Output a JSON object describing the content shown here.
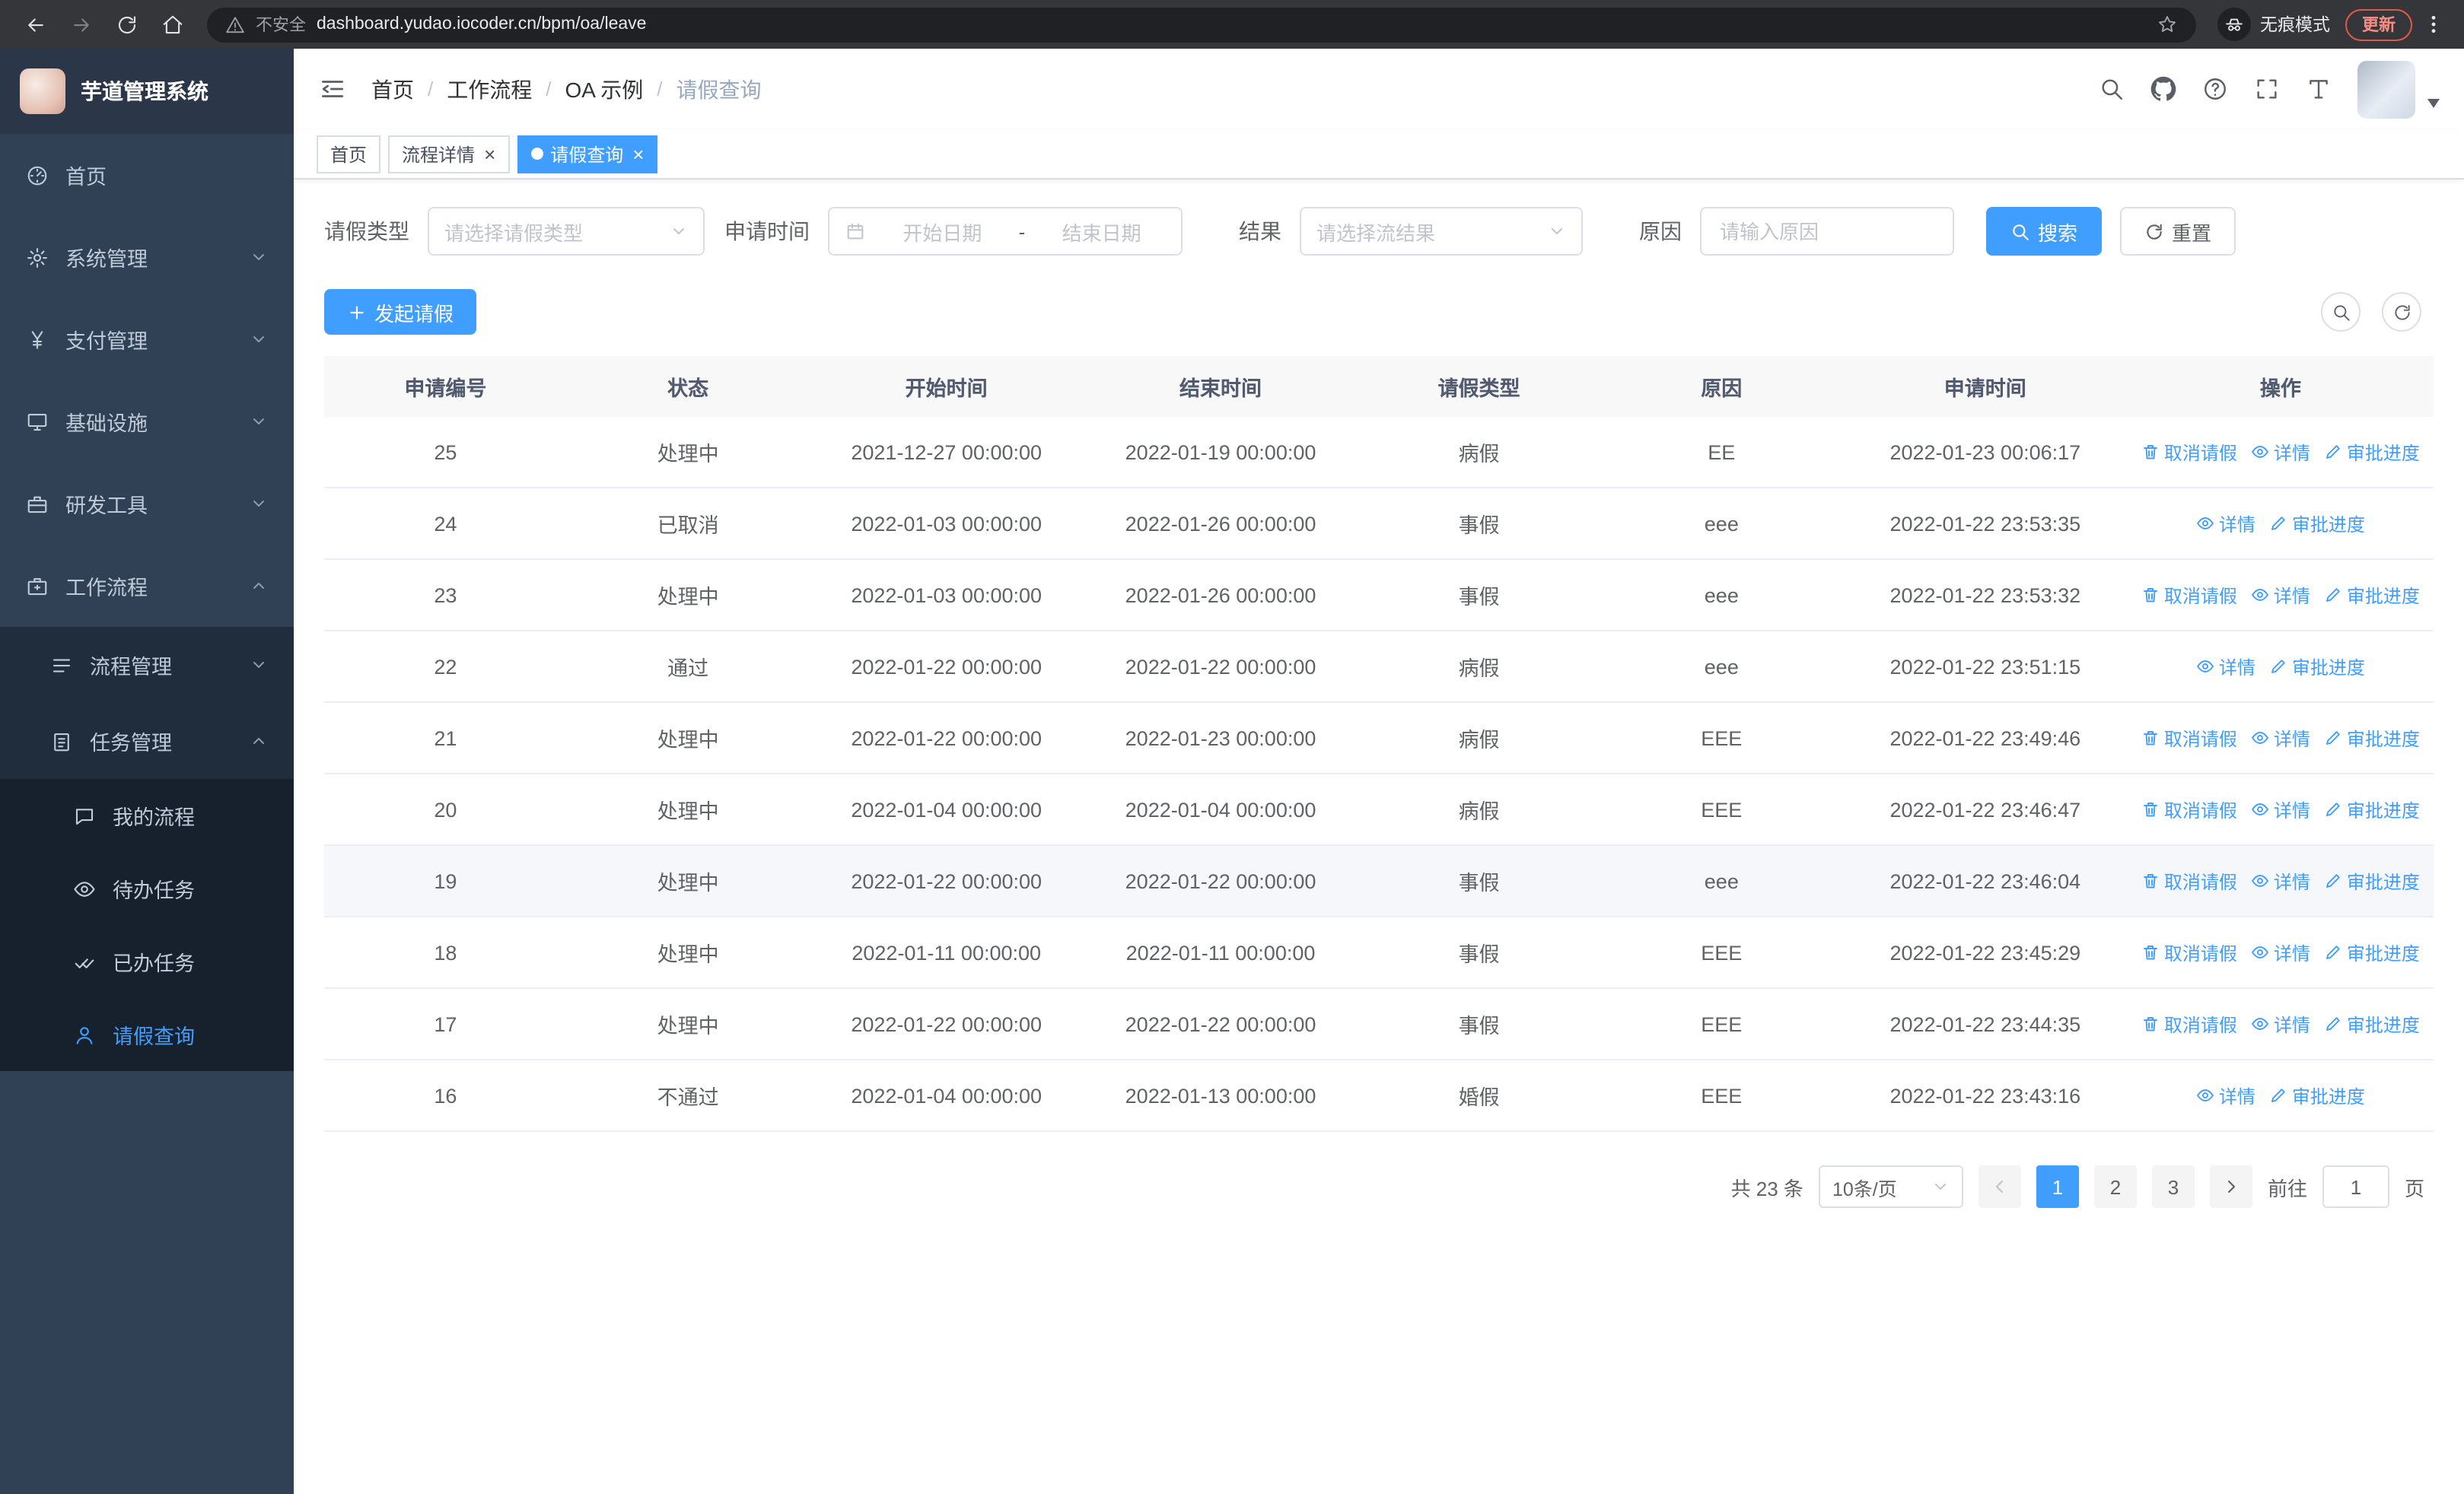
{
  "colors": {
    "primary": "#409eff",
    "sidebar_bg": "#304156",
    "submenu_bg": "#1f2d3d"
  },
  "icons": {
    "close": "×"
  },
  "browser": {
    "warning": "不安全",
    "url": "dashboard.yudao.iocoder.cn/bpm/oa/leave",
    "incognito": "无痕模式",
    "update": "更新"
  },
  "sidebar": {
    "title": "芋道管理系统",
    "home": "首页",
    "system": "系统管理",
    "payment": "支付管理",
    "infra": "基础设施",
    "devtools": "研发工具",
    "workflow": "工作流程",
    "process_mgmt": "流程管理",
    "task_mgmt": "任务管理",
    "my_process": "我的流程",
    "todo_task": "待办任务",
    "done_task": "已办任务",
    "leave_query": "请假查询"
  },
  "breadcrumb": {
    "home": "首页",
    "workflow": "工作流程",
    "oa": "OA 示例",
    "current": "请假查询"
  },
  "tabs": {
    "home": "首页",
    "process_detail": "流程详情",
    "leave_query": "请假查询"
  },
  "filters": {
    "leave_type_label": "请假类型",
    "leave_type_placeholder": "请选择请假类型",
    "apply_time_label": "申请时间",
    "start_date_placeholder": "开始日期",
    "range_separator": "-",
    "end_date_placeholder": "结束日期",
    "result_label": "结果",
    "result_placeholder": "请选择流结果",
    "reason_label": "原因",
    "reason_placeholder": "请输入原因",
    "search_button": "搜索",
    "reset_button": "重置"
  },
  "toolbar": {
    "create_button": "发起请假"
  },
  "actions": {
    "cancel": "取消请假",
    "detail": "详情",
    "progress": "审批进度"
  },
  "table": {
    "columns": [
      "申请编号",
      "状态",
      "开始时间",
      "结束时间",
      "请假类型",
      "原因",
      "申请时间",
      "操作"
    ],
    "rows": [
      {
        "id": "25",
        "status": "处理中",
        "start": "2021-12-27 00:00:00",
        "end": "2022-01-19 00:00:00",
        "type": "病假",
        "reason": "EE",
        "applied": "2022-01-23 00:06:17"
      },
      {
        "id": "24",
        "status": "已取消",
        "start": "2022-01-03 00:00:00",
        "end": "2022-01-26 00:00:00",
        "type": "事假",
        "reason": "eee",
        "applied": "2022-01-22 23:53:35"
      },
      {
        "id": "23",
        "status": "处理中",
        "start": "2022-01-03 00:00:00",
        "end": "2022-01-26 00:00:00",
        "type": "事假",
        "reason": "eee",
        "applied": "2022-01-22 23:53:32"
      },
      {
        "id": "22",
        "status": "通过",
        "start": "2022-01-22 00:00:00",
        "end": "2022-01-22 00:00:00",
        "type": "病假",
        "reason": "eee",
        "applied": "2022-01-22 23:51:15"
      },
      {
        "id": "21",
        "status": "处理中",
        "start": "2022-01-22 00:00:00",
        "end": "2022-01-23 00:00:00",
        "type": "病假",
        "reason": "EEE",
        "applied": "2022-01-22 23:49:46"
      },
      {
        "id": "20",
        "status": "处理中",
        "start": "2022-01-04 00:00:00",
        "end": "2022-01-04 00:00:00",
        "type": "病假",
        "reason": "EEE",
        "applied": "2022-01-22 23:46:47"
      },
      {
        "id": "19",
        "status": "处理中",
        "start": "2022-01-22 00:00:00",
        "end": "2022-01-22 00:00:00",
        "type": "事假",
        "reason": "eee",
        "applied": "2022-01-22 23:46:04"
      },
      {
        "id": "18",
        "status": "处理中",
        "start": "2022-01-11 00:00:00",
        "end": "2022-01-11 00:00:00",
        "type": "事假",
        "reason": "EEE",
        "applied": "2022-01-22 23:45:29"
      },
      {
        "id": "17",
        "status": "处理中",
        "start": "2022-01-22 00:00:00",
        "end": "2022-01-22 00:00:00",
        "type": "事假",
        "reason": "EEE",
        "applied": "2022-01-22 23:44:35"
      },
      {
        "id": "16",
        "status": "不通过",
        "start": "2022-01-04 00:00:00",
        "end": "2022-01-13 00:00:00",
        "type": "婚假",
        "reason": "EEE",
        "applied": "2022-01-22 23:43:16"
      }
    ]
  },
  "pagination": {
    "total": "共 23 条",
    "size": "10条/页",
    "p1": "1",
    "p2": "2",
    "p3": "3",
    "goto": "前往",
    "goto_value": "1",
    "unit": "页"
  }
}
